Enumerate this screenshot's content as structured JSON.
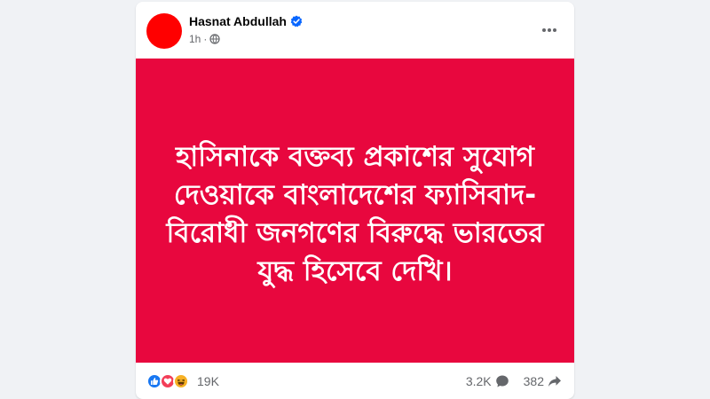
{
  "post": {
    "author": "Hasnat Abdullah",
    "verified": true,
    "timestamp": "1h",
    "separator": "·",
    "audience_icon": "globe-icon",
    "more_icon": "more-horizontal-icon"
  },
  "media": {
    "background_color": "#e8073e",
    "text_color": "#ffffff",
    "text": "হাসিনাকে বক্তব্য প্রকাশের সুযোগ দেওয়াকে বাংলাদেশের ফ্যাসিবাদ-বিরোধী জনগণের বিরুদ্ধে ভারতের যুদ্ধ হিসেবে দেখি।"
  },
  "engagement": {
    "reactions": [
      "like-icon",
      "love-icon",
      "haha-icon"
    ],
    "reaction_count": "19K",
    "comment_count": "3.2K",
    "comment_icon": "comment-icon",
    "share_count": "382",
    "share_icon": "share-icon"
  },
  "colors": {
    "avatar": "#ff0000",
    "verified": "#0866ff",
    "like": "#1877f2",
    "love": "#f33e58",
    "haha": "#f7b125"
  }
}
